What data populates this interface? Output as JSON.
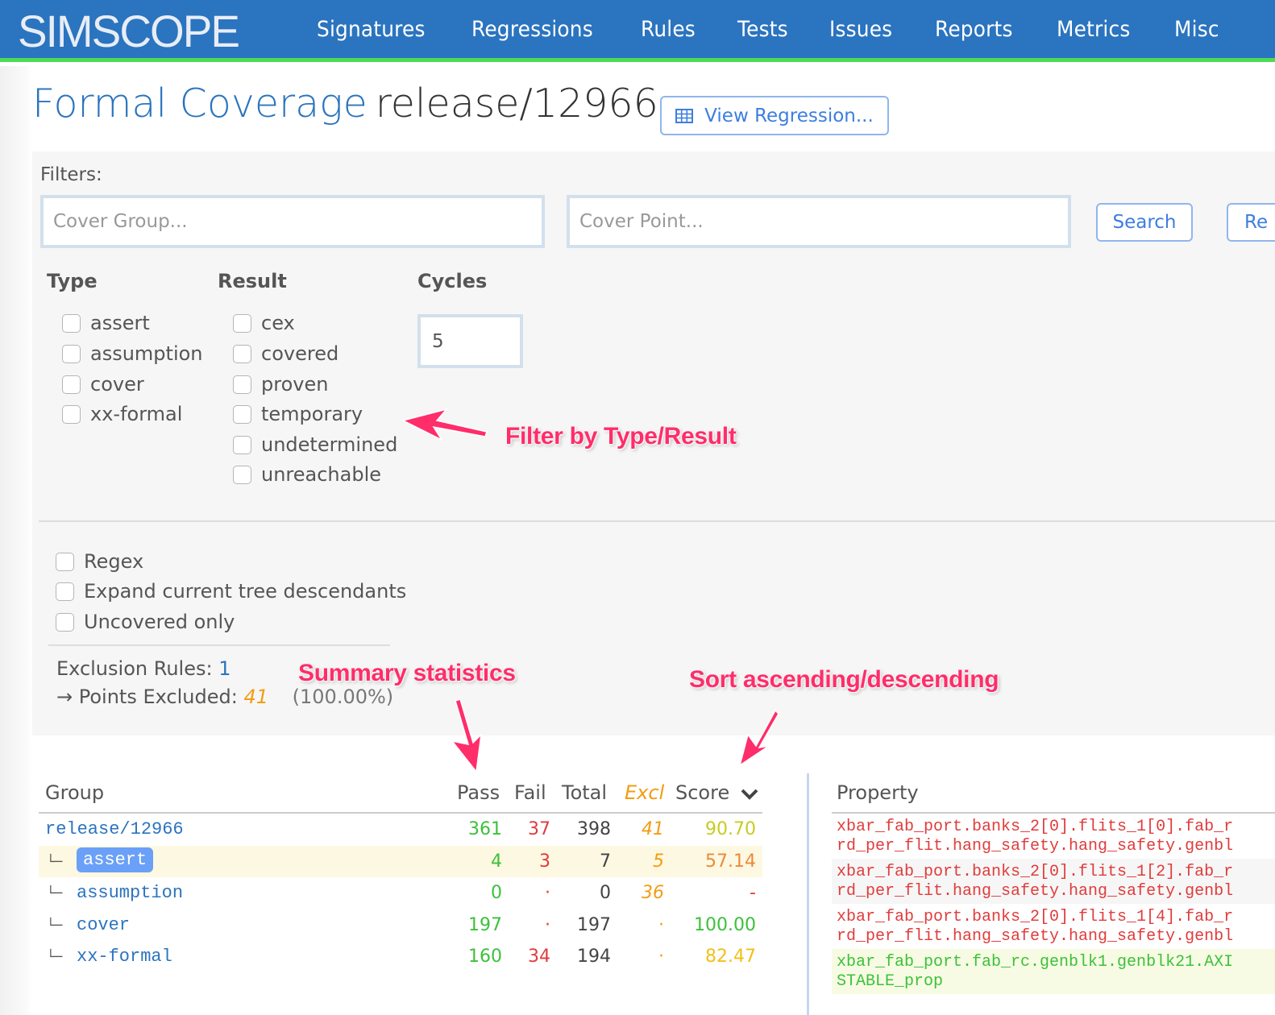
{
  "navbar": {
    "brand": "SIMSCOPE",
    "items": [
      "Signatures",
      "Regressions",
      "Rules",
      "Tests",
      "Issues",
      "Reports",
      "Metrics",
      "Misc"
    ],
    "colors": {
      "background": "#2b74bf",
      "accent_border": "#4cdb57"
    }
  },
  "header": {
    "title_prefix": "Formal Coverage",
    "title_name": "release/12966",
    "view_regression_label": "View Regression..."
  },
  "filters": {
    "label": "Filters:",
    "cover_group": {
      "value": "",
      "placeholder": "Cover Group..."
    },
    "cover_point": {
      "value": "",
      "placeholder": "Cover Point..."
    },
    "search_label": "Search",
    "reset_label": "Re",
    "type": {
      "heading": "Type",
      "options": [
        {
          "label": "assert",
          "checked": false
        },
        {
          "label": "assumption",
          "checked": false
        },
        {
          "label": "cover",
          "checked": false
        },
        {
          "label": "xx-formal",
          "checked": false
        }
      ]
    },
    "result": {
      "heading": "Result",
      "options": [
        {
          "label": "cex",
          "checked": false
        },
        {
          "label": "covered",
          "checked": false
        },
        {
          "label": "proven",
          "checked": false
        },
        {
          "label": "temporary",
          "checked": false
        },
        {
          "label": "undetermined",
          "checked": false
        },
        {
          "label": "unreachable",
          "checked": false
        }
      ]
    },
    "cycles": {
      "heading": "Cycles",
      "value": "5"
    },
    "options": [
      {
        "label": "Regex",
        "checked": false
      },
      {
        "label": "Expand current tree descendants",
        "checked": false
      },
      {
        "label": "Uncovered only",
        "checked": false
      }
    ],
    "exclusion": {
      "rules_label": "Exclusion Rules:",
      "rules_count": "1",
      "points_label": "→ Points Excluded:",
      "points_count": "41",
      "points_pct": "(100.00%)"
    }
  },
  "annotations": {
    "filter": "Filter by Type/Result",
    "summary": "Summary statistics",
    "sort": "Sort ascending/descending"
  },
  "group_table": {
    "headers": {
      "group": "Group",
      "pass": "Pass",
      "fail": "Fail",
      "total": "Total",
      "excl": "Excl",
      "score": "Score"
    },
    "sort_column": "Score",
    "sort_direction": "descending",
    "tree_glyph": "└─",
    "rows": [
      {
        "group": "release/12966",
        "pass": "361",
        "fail": "37",
        "total": "398",
        "excl": "41",
        "score": "90.70",
        "score_color": "#c8cc1e",
        "level": 0
      },
      {
        "group": "assert",
        "pass": "4",
        "fail": "3",
        "total": "7",
        "excl": "5",
        "score": "57.14",
        "score_color": "#ec8a3c",
        "level": 1,
        "selected": true
      },
      {
        "group": "assumption",
        "pass": "0",
        "fail": "·",
        "total": "0",
        "excl": "36",
        "score": "-",
        "score_color": "#e03c3c",
        "level": 1
      },
      {
        "group": "cover",
        "pass": "197",
        "fail": "·",
        "total": "197",
        "excl": "·",
        "score": "100.00",
        "score_color": "#3cc13b",
        "level": 1
      },
      {
        "group": "xx-formal",
        "pass": "160",
        "fail": "34",
        "total": "194",
        "excl": "·",
        "score": "82.47",
        "score_color": "#f2c018",
        "level": 1
      }
    ]
  },
  "property_table": {
    "header": "Property",
    "rows": [
      {
        "lines": [
          "xbar_fab_port.banks_2[0].flits_1[0].fab_r",
          "rd_per_flit.hang_safety.hang_safety.genbl"
        ],
        "status": "fail"
      },
      {
        "lines": [
          "xbar_fab_port.banks_2[0].flits_1[2].fab_r",
          "rd_per_flit.hang_safety.hang_safety.genbl"
        ],
        "status": "fail"
      },
      {
        "lines": [
          "xbar_fab_port.banks_2[0].flits_1[4].fab_r",
          "rd_per_flit.hang_safety.hang_safety.genbl"
        ],
        "status": "fail"
      },
      {
        "lines": [
          "xbar_fab_port.fab_rc.genblk1.genblk21.AXI",
          "STABLE_prop"
        ],
        "status": "pass"
      }
    ]
  }
}
